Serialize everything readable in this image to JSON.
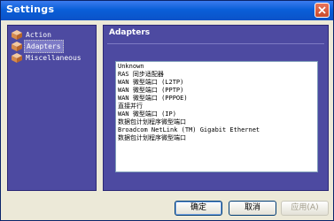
{
  "window": {
    "title": "Settings"
  },
  "sidebar": {
    "items": [
      {
        "label": "Action",
        "selected": false
      },
      {
        "label": "Adapters",
        "selected": true
      },
      {
        "label": "Miscellaneous",
        "selected": false
      }
    ]
  },
  "panel": {
    "header": "Adapters",
    "adapters": [
      "Unknown",
      "RAS 同步适配器",
      "WAN 微型端口 (L2TP)",
      "WAN 微型端口 (PPTP)",
      "WAN 微型端口 (PPPOE)",
      "直接并行",
      "WAN 微型端口 (IP)",
      "数据包计划程序微型端口",
      "Broadcom NetLink (TM) Gigabit Ethernet",
      "数据包计划程序微型端口"
    ]
  },
  "buttons": {
    "ok": "确定",
    "cancel": "取消",
    "apply": "应用(A)"
  },
  "colors": {
    "titlebar": "#0a5fd8",
    "panel_bg": "#4d4aa1",
    "dialog_bg": "#ece9d8"
  }
}
